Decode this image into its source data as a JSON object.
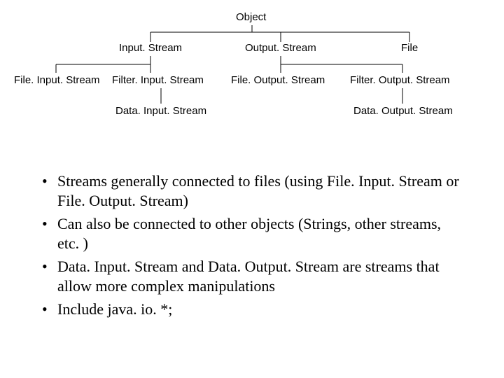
{
  "tree": {
    "root": "Object",
    "level1": {
      "input": "Input. Stream",
      "output": "Output. Stream",
      "file": "File"
    },
    "level2": {
      "file_input": "File. Input. Stream",
      "filter_input": "Filter. Input. Stream",
      "file_output": "File. Output. Stream",
      "filter_output": "Filter. Output. Stream"
    },
    "level3": {
      "data_input": "Data. Input. Stream",
      "data_output": "Data. Output. Stream"
    }
  },
  "bullets": {
    "b1": "Streams generally connected to files (using File. Input. Stream or File. Output. Stream)",
    "b2": "Can also be connected to other objects (Strings, other streams, etc. )",
    "b3": "Data. Input. Stream and Data. Output. Stream are streams that allow more complex manipulations",
    "b4": "Include java. io. *;"
  }
}
